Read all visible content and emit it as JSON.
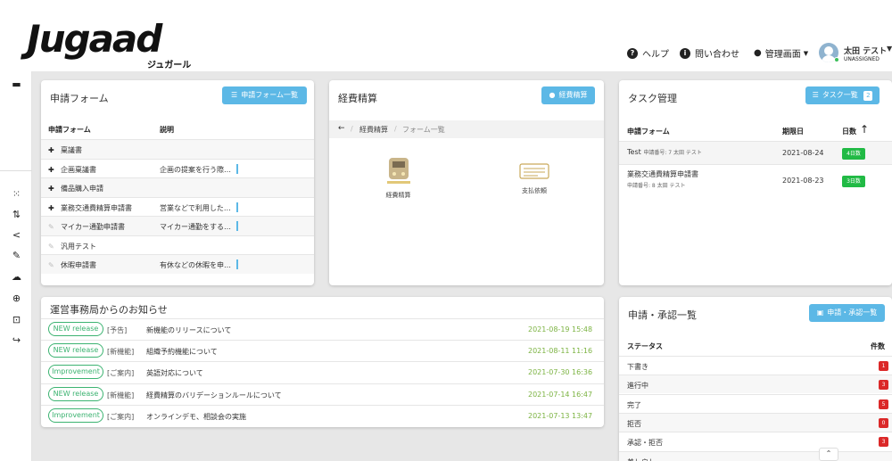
{
  "brand": {
    "logo": "Jugaad",
    "sub": "ジュガール"
  },
  "header": {
    "help": "ヘルプ",
    "contact": "問い合わせ",
    "admin": "管理画面",
    "user_name": "太田 テスト",
    "user_role": "UNASSIGNED"
  },
  "forms_card": {
    "title": "申請フォーム",
    "button": "申請フォーム一覧",
    "col_form": "申請フォーム",
    "col_desc": "説明",
    "rows": [
      {
        "name": "稟議書",
        "desc": "",
        "pinned": true
      },
      {
        "name": "企画稟議書",
        "desc": "企画の提案を行う際…",
        "pinned": true
      },
      {
        "name": "備品購入申請",
        "desc": "",
        "pinned": true
      },
      {
        "name": "業務交通費精算申請書",
        "desc": "営業などで利用した…",
        "pinned": true
      },
      {
        "name": "マイカー通勤申請書",
        "desc": "マイカー通勤をする…",
        "pinned": false
      },
      {
        "name": "汎用テスト",
        "desc": "",
        "pinned": false
      },
      {
        "name": "休暇申請書",
        "desc": "有休などの休暇を申…",
        "pinned": false
      }
    ]
  },
  "expense_card": {
    "title": "経費精算",
    "button": "経費精算",
    "breadcrumb": [
      "経費精算",
      "フォーム一覧"
    ],
    "tiles": [
      {
        "label": "経費精算",
        "icon": "train-icon"
      },
      {
        "label": "支払依頼",
        "icon": "payment-terminal-icon"
      }
    ]
  },
  "tasks_card": {
    "title": "タスク管理",
    "button": "タスク一覧",
    "button_count": "2",
    "col_form": "申請フォーム",
    "col_due": "期限日",
    "col_days": "日数",
    "rows": [
      {
        "name": "Test",
        "meta": "申請番号: 7  太田 テスト",
        "due": "2021-08-24",
        "days": "4日数"
      },
      {
        "name": "業務交通費精算申請書",
        "meta": "申請番号: 8  太田 テスト",
        "due": "2021-08-23",
        "days": "3日数"
      }
    ]
  },
  "news_card": {
    "title": "運営事務局からのお知らせ",
    "items": [
      {
        "tag": "NEW release",
        "cat": "[予告]",
        "text": "新機能のリリースについて",
        "date": "2021-08-19 15:48"
      },
      {
        "tag": "NEW release",
        "cat": "[新機能]",
        "text": "組織予約機能について",
        "date": "2021-08-11 11:16"
      },
      {
        "tag": "Improvement",
        "cat": "[ご案内]",
        "text": "英語対応について",
        "date": "2021-07-30 16:36"
      },
      {
        "tag": "NEW release",
        "cat": "[新機能]",
        "text": "経費精算のバリデーションルールについて",
        "date": "2021-07-14 16:47"
      },
      {
        "tag": "Improvement",
        "cat": "[ご案内]",
        "text": "オンラインデモ、相談会の実施",
        "date": "2021-07-13 13:47"
      }
    ]
  },
  "approval_card": {
    "title": "申請・承認一覧",
    "button": "申請・承認一覧",
    "col_status": "ステータス",
    "col_count": "件数",
    "rows": [
      {
        "status": "下書き",
        "count": "1"
      },
      {
        "status": "進行中",
        "count": "3"
      },
      {
        "status": "完了",
        "count": "5"
      },
      {
        "status": "拒否",
        "count": "0"
      },
      {
        "status": "承認・拒否",
        "count": "3"
      },
      {
        "status": "差し戻し",
        "count": ""
      }
    ]
  },
  "colors": {
    "accent": "#5cb8e6",
    "green": "#21ba45",
    "red": "#db2828",
    "date_green": "#7cb342"
  }
}
